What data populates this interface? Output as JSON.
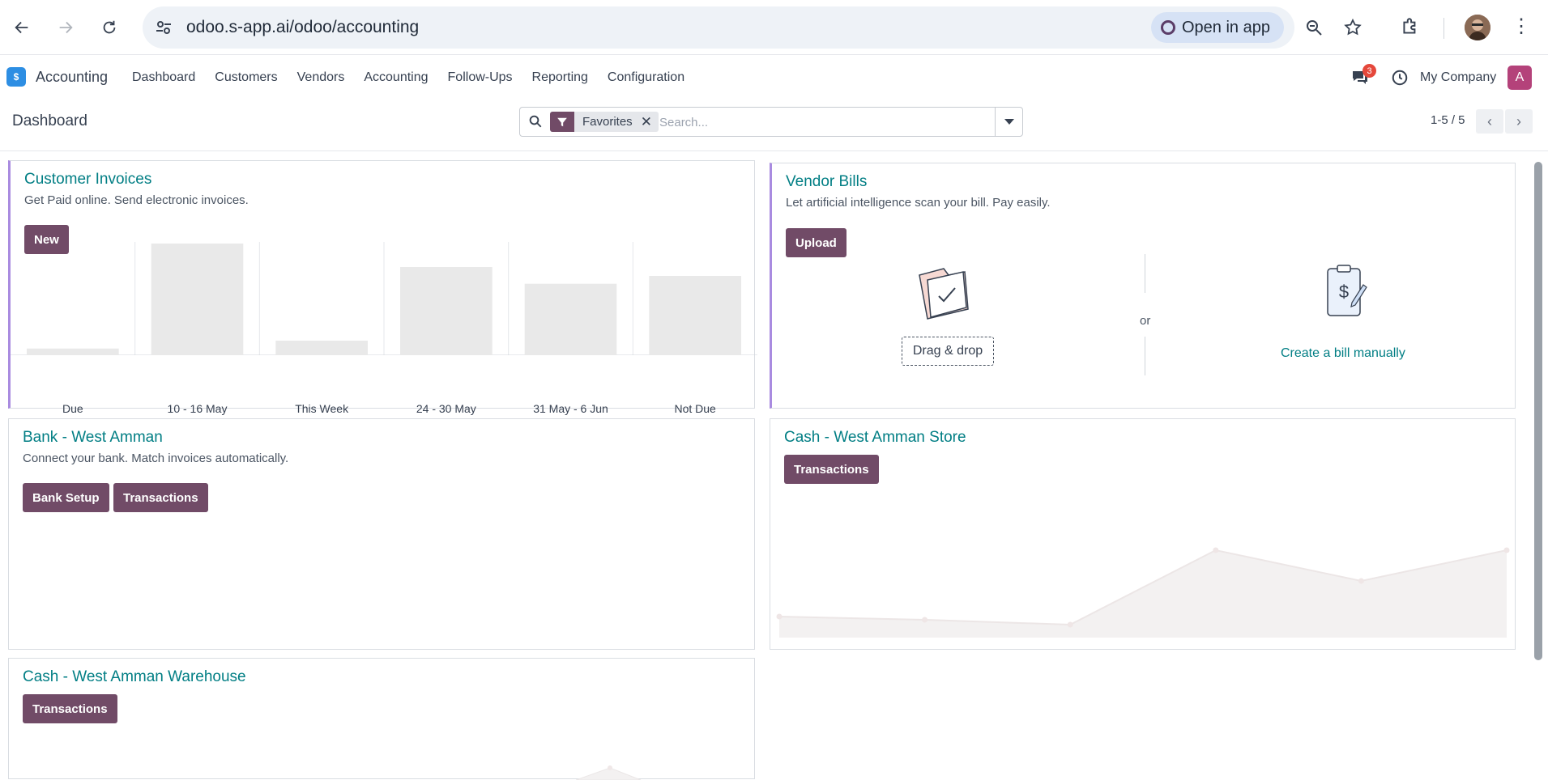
{
  "browser": {
    "url": "odoo.s-app.ai/odoo/accounting",
    "open_in_app": "Open in app"
  },
  "navbar": {
    "app_name": "Accounting",
    "menu": [
      "Dashboard",
      "Customers",
      "Vendors",
      "Accounting",
      "Follow-Ups",
      "Reporting",
      "Configuration"
    ],
    "chat_badge": "3",
    "company": "My Company",
    "avatar_letter": "A"
  },
  "control": {
    "title": "Dashboard",
    "facet_label": "Favorites",
    "search_placeholder": "Search...",
    "pager": "1-5 / 5"
  },
  "cards": {
    "customer_invoices": {
      "title": "Customer Invoices",
      "subtitle": "Get Paid online. Send electronic invoices.",
      "button": "New"
    },
    "vendor_bills": {
      "title": "Vendor Bills",
      "subtitle": "Let artificial intelligence scan your bill. Pay easily.",
      "button": "Upload",
      "drag_drop": "Drag & drop",
      "or": "or",
      "create_manual": "Create a bill manually"
    },
    "bank": {
      "title": "Bank - West Amman",
      "subtitle": "Connect your bank. Match invoices automatically.",
      "button_setup": "Bank Setup",
      "button_transactions": "Transactions"
    },
    "cash_store": {
      "title": "Cash - West Amman Store",
      "button_transactions": "Transactions"
    },
    "cash_warehouse": {
      "title": "Cash - West Amman Warehouse",
      "button_transactions": "Transactions"
    }
  },
  "chart_data": [
    {
      "type": "bar",
      "categories": [
        "Due",
        "10 - 16 May",
        "This Week",
        "24 - 30 May",
        "31 May - 6 Jun",
        "Not Due"
      ],
      "values": [
        6,
        100,
        13,
        79,
        64,
        71
      ],
      "ylim": [
        0,
        100
      ],
      "grid": true,
      "color": "#e9e9e9"
    },
    {
      "type": "area",
      "points": [
        18,
        14,
        8,
        100,
        62,
        100
      ],
      "color": "#f3f1f1"
    }
  ]
}
